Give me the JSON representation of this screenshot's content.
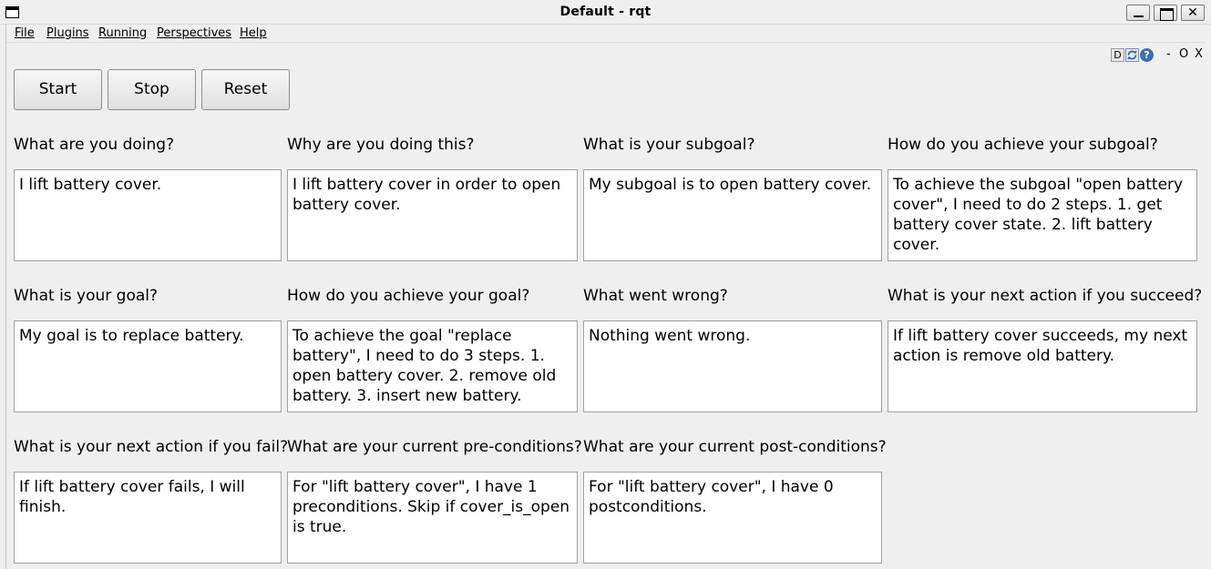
{
  "window": {
    "title": "Default - rqt"
  },
  "menu": [
    "File",
    "Plugins",
    "Running",
    "Perspectives",
    "Help"
  ],
  "dock_toolbar": {
    "d_label": "D",
    "help_label": "?",
    "minimize_label": "-",
    "float_label": "O",
    "close_label": "X"
  },
  "buttons": {
    "start": "Start",
    "stop": "Stop",
    "reset": "Reset"
  },
  "questions": [
    {
      "label": "What are you doing?",
      "value": "I lift battery cover."
    },
    {
      "label": "Why are you doing this?",
      "value": "I lift battery cover in order to open battery cover."
    },
    {
      "label": "What is your subgoal?",
      "value": "My subgoal is to open battery cover."
    },
    {
      "label": "How do you achieve your subgoal?",
      "value": "To achieve the subgoal \"open battery cover\", I need to do 2 steps. 1. get battery cover state. 2. lift battery cover."
    },
    {
      "label": "What is your goal?",
      "value": "My goal is to replace battery."
    },
    {
      "label": "How do you achieve your goal?",
      "value": "To achieve the goal \"replace battery\", I need to do 3 steps. 1. open battery cover. 2. remove old battery. 3. insert new battery."
    },
    {
      "label": "What went wrong?",
      "value": "Nothing went wrong."
    },
    {
      "label": "What is your next action if you succeed?",
      "value": "If lift battery cover succeeds, my next action is remove old battery."
    },
    {
      "label": "What is your next action if you fail?",
      "value": "If lift battery cover fails, I will finish."
    },
    {
      "label": "What are your current pre-conditions?",
      "value": "For \"lift battery cover\", I have 1 preconditions. Skip if cover_is_open is true."
    },
    {
      "label": "What are your current post-conditions?",
      "value": "For \"lift battery cover\", I have 0 postconditions."
    }
  ]
}
